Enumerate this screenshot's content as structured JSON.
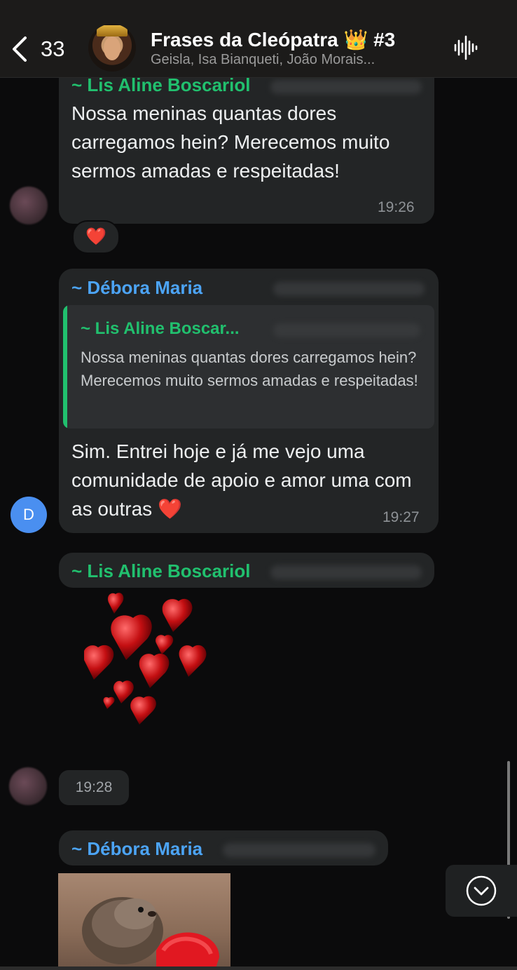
{
  "header": {
    "back_count": "33",
    "title": "Frases da Cleópatra 👑 #3",
    "members": "Geisla, Isa Bianqueti, João Morais..."
  },
  "messages": [
    {
      "sender": "~ Lis Aline Boscariol",
      "text": "Nossa meninas quantas dores carregamos hein? Merecemos muito sermos amadas e respeitadas!",
      "time": "19:26",
      "reaction": "❤️"
    },
    {
      "sender": "~ Débora Maria",
      "avatar_letter": "D",
      "quote": {
        "sender": "~ Lis Aline Boscar...",
        "text": "Nossa meninas quantas dores carregamos hein? Merecemos muito sermos amadas e respeitadas!"
      },
      "text": "Sim. Entrei hoje e já me vejo uma comunidade de apoio e amor uma com as outras ❤️",
      "time": "19:27"
    },
    {
      "sender": "~ Lis Aline Boscariol",
      "sticker": "hearts-sticker",
      "time": "19:28"
    },
    {
      "sender": "~ Débora Maria",
      "image": "otter-heart-image"
    }
  ],
  "colors": {
    "background": "#0b0b0c",
    "bubble": "#232526",
    "sender_green": "#21c06e",
    "sender_blue": "#4ca4f5"
  },
  "icons": [
    "back-chevron-icon",
    "voice-waveform-icon",
    "scroll-down-icon",
    "heart-reaction-icon"
  ]
}
